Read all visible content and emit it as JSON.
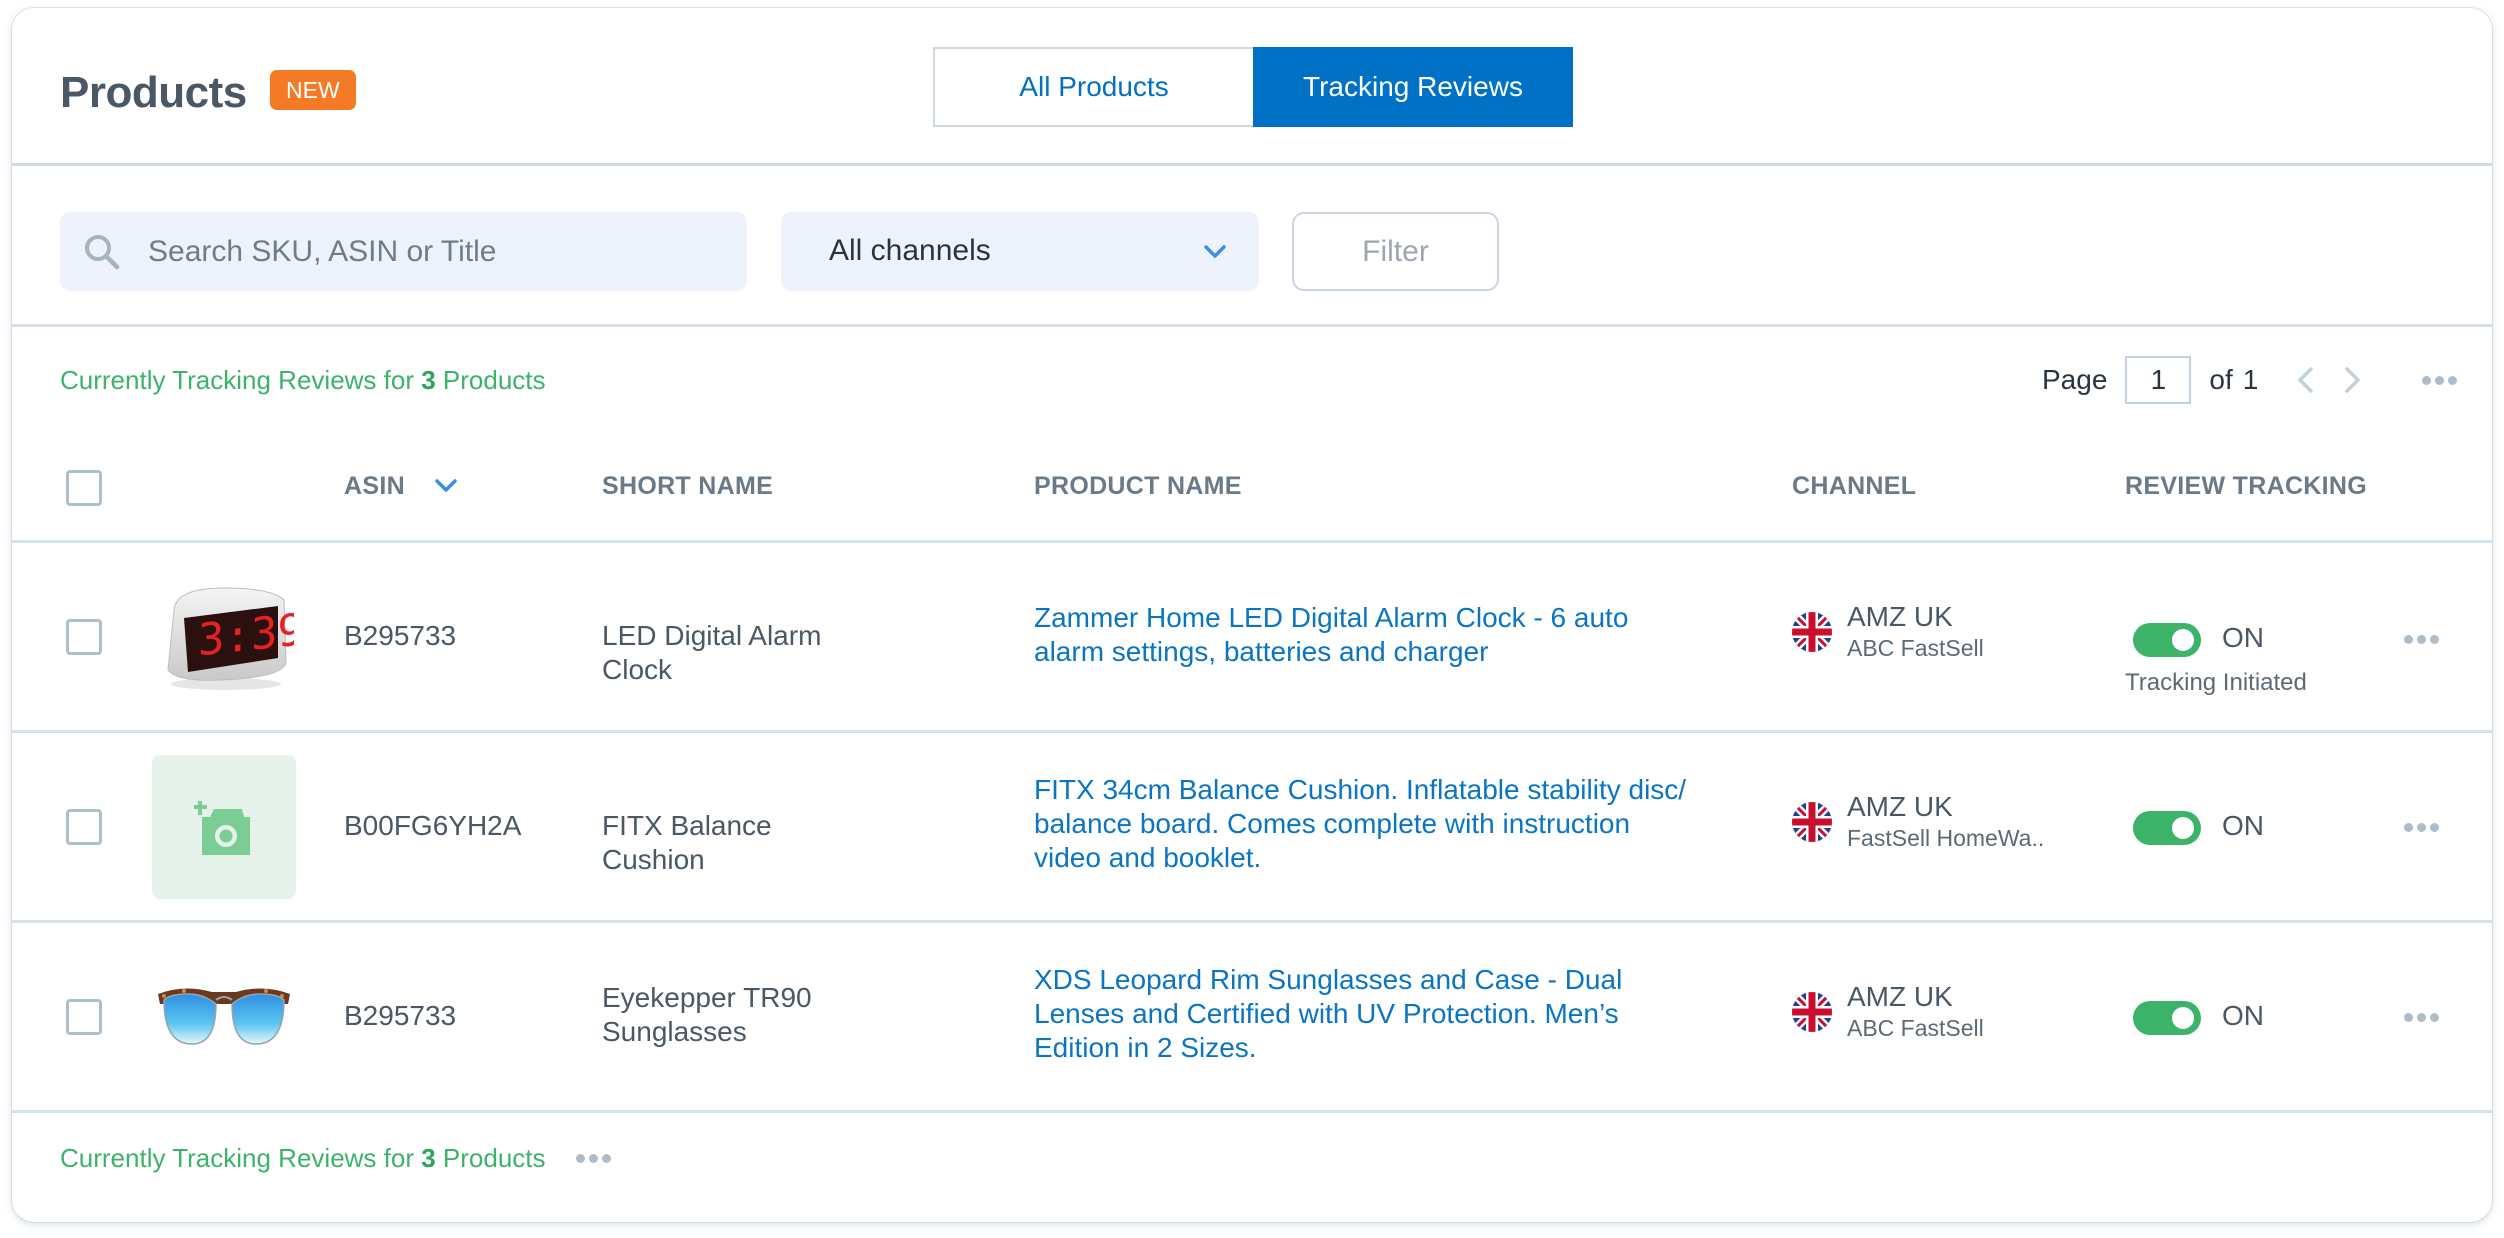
{
  "header": {
    "title": "Products",
    "badge": "NEW",
    "tabs": [
      {
        "label": "All Products",
        "active": false
      },
      {
        "label": "Tracking Reviews",
        "active": true
      }
    ]
  },
  "toolbar": {
    "search_placeholder": "Search SKU, ASIN or Title",
    "search_value": "",
    "channel_select": "All channels",
    "filter_label": "Filter"
  },
  "summary": {
    "prefix": "Currently Tracking Reviews for ",
    "count": "3",
    "suffix": " Products"
  },
  "pagination": {
    "page_label": "Page",
    "current_page": "1",
    "of_label": "of",
    "total_pages": "1"
  },
  "table": {
    "columns": {
      "asin": "ASIN",
      "short_name": "SHORT NAME",
      "product_name": "PRODUCT NAME",
      "channel": "CHANNEL",
      "review_tracking": "REVIEW TRACKING"
    },
    "rows": [
      {
        "image": "led-alarm-clock",
        "asin": "B295733",
        "short_name": "LED Digital Alarm Clock",
        "product_name": "Zammer Home LED Digital Alarm Clock - 6 auto alarm settings, batteries and charger",
        "channel": "AMZ UK",
        "seller": "ABC FastSell",
        "flag": "uk-flag",
        "tracking": "ON",
        "tracking_on": true,
        "status": "Tracking Initiated"
      },
      {
        "image": "add-photo-placeholder",
        "asin": "B00FG6YH2A",
        "short_name": "FITX Balance Cushion",
        "product_name": "FITX 34cm Balance Cushion. Inflatable stability disc/ balance board. Comes complete with instruction video and booklet.",
        "channel": "AMZ UK",
        "seller": "FastSell HomeWa..",
        "flag": "uk-flag",
        "tracking": "ON",
        "tracking_on": true,
        "status": ""
      },
      {
        "image": "sunglasses",
        "asin": "B295733",
        "short_name": "Eyekepper TR90 Sunglasses",
        "product_name": "XDS Leopard Rim Sunglasses and Case - Dual Lenses and Certified with UV Protection. Men’s Edition in 2 Sizes.",
        "channel": "AMZ UK",
        "seller": "ABC FastSell",
        "flag": "uk-flag",
        "tracking": "ON",
        "tracking_on": true,
        "status": ""
      }
    ]
  },
  "colors": {
    "primary": "#0071c5",
    "badge": "#f47a25",
    "success": "#3db36a",
    "text": "#4a5866",
    "border": "#d6e2ec"
  }
}
